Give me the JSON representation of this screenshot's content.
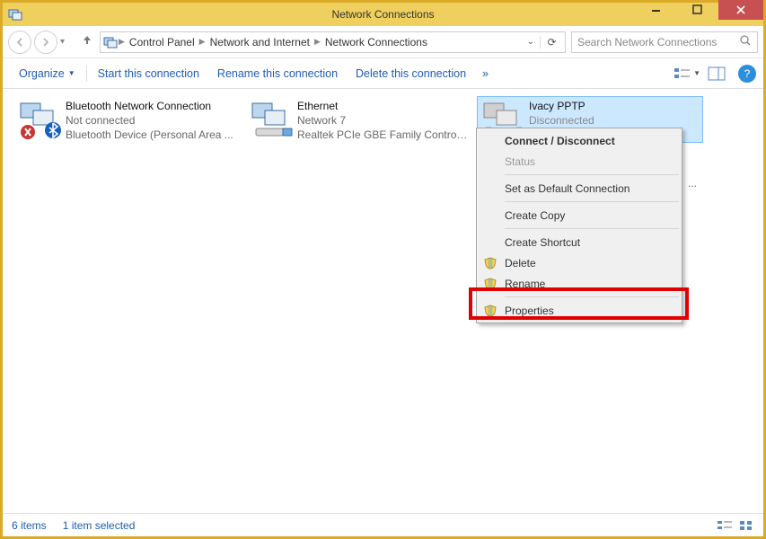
{
  "window": {
    "title": "Network Connections"
  },
  "breadcrumb": {
    "items": [
      "Control Panel",
      "Network and Internet",
      "Network Connections"
    ]
  },
  "search": {
    "placeholder": "Search Network Connections"
  },
  "toolbar": {
    "organize": "Organize",
    "start": "Start this connection",
    "rename": "Rename this connection",
    "delete": "Delete this connection"
  },
  "connections": [
    {
      "name": "Bluetooth Network Connection",
      "status": "Not connected",
      "device": "Bluetooth Device (Personal Area ..."
    },
    {
      "name": "Ethernet",
      "status": "Network  7",
      "device": "Realtek PCIe GBE Family Controller"
    },
    {
      "name": "Ivacy PPTP",
      "status": "Disconnected",
      "device": ""
    }
  ],
  "overflow_label": "...",
  "context_menu": {
    "connect": "Connect / Disconnect",
    "status": "Status",
    "default": "Set as Default Connection",
    "copy": "Create Copy",
    "shortcut": "Create Shortcut",
    "delete": "Delete",
    "rename": "Rename",
    "properties": "Properties"
  },
  "statusbar": {
    "count": "6 items",
    "selected": "1 item selected"
  }
}
